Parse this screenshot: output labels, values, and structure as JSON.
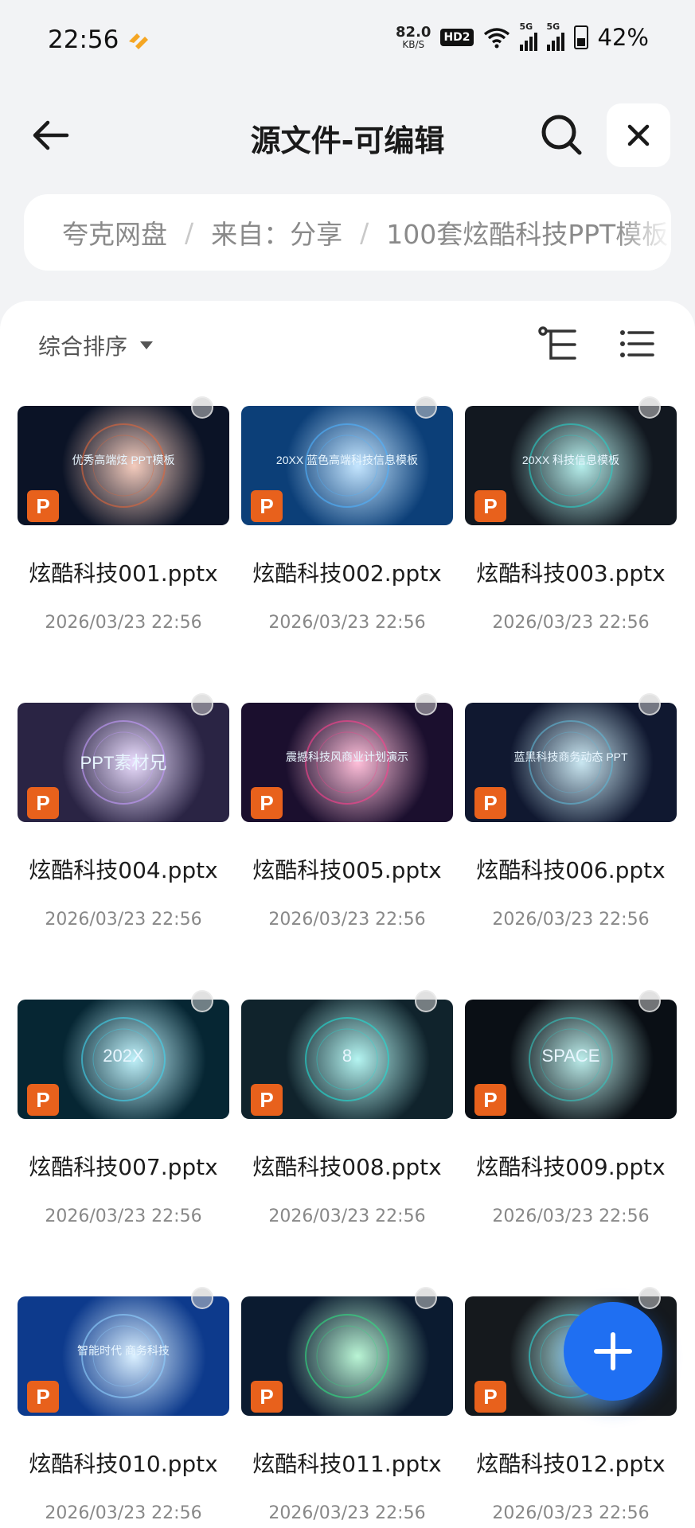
{
  "status_bar": {
    "time": "22:56",
    "net_speed_value": "82.0",
    "net_speed_unit": "KB/S",
    "hd_label": "HD2",
    "signal1_tag": "5G",
    "signal2_tag": "5G",
    "battery_pct": "42%"
  },
  "header": {
    "title": "源文件-可编辑"
  },
  "breadcrumb": {
    "items": [
      "夸克网盘",
      "来自：分享",
      "100套炫酷科技PPT模板"
    ]
  },
  "toolbar": {
    "sort_label": "综合排序"
  },
  "files": [
    {
      "name": "炫酷科技001.pptx",
      "date": "2026/03/23 22:56",
      "thumb_text": "优秀高端炫 PPT模板",
      "thumb_bg": "#0b1326",
      "accent": "#e0663a"
    },
    {
      "name": "炫酷科技002.pptx",
      "date": "2026/03/23 22:56",
      "thumb_text": "20XX 蓝色高端科技信息模板",
      "thumb_bg": "#0c3f78",
      "accent": "#4fb3ff"
    },
    {
      "name": "炫酷科技003.pptx",
      "date": "2026/03/23 22:56",
      "thumb_text": "20XX 科技信息模板",
      "thumb_bg": "#121820",
      "accent": "#26d0c8"
    },
    {
      "name": "炫酷科技004.pptx",
      "date": "2026/03/23 22:56",
      "thumb_text": "PPT素材兄",
      "thumb_bg": "#2a2444",
      "accent": "#c49bff"
    },
    {
      "name": "炫酷科技005.pptx",
      "date": "2026/03/23 22:56",
      "thumb_text": "震撼科技风商业计划演示",
      "thumb_bg": "#1b0f2e",
      "accent": "#ff3f8e"
    },
    {
      "name": "炫酷科技006.pptx",
      "date": "2026/03/23 22:56",
      "thumb_text": "蓝黑科技商务动态 PPT",
      "thumb_bg": "#101830",
      "accent": "#5fb7d6"
    },
    {
      "name": "炫酷科技007.pptx",
      "date": "2026/03/23 22:56",
      "thumb_text": "202X",
      "thumb_bg": "#062633",
      "accent": "#3fd6f0"
    },
    {
      "name": "炫酷科技008.pptx",
      "date": "2026/03/23 22:56",
      "thumb_text": "8",
      "thumb_bg": "#10232c",
      "accent": "#1fe0d6"
    },
    {
      "name": "炫酷科技009.pptx",
      "date": "2026/03/23 22:56",
      "thumb_text": "SPACE",
      "thumb_bg": "#0a0f15",
      "accent": "#34c7c0"
    },
    {
      "name": "炫酷科技010.pptx",
      "date": "2026/03/23 22:56",
      "thumb_text": "智能时代 商务科技",
      "thumb_bg": "#0d3a8c",
      "accent": "#8fd0ff"
    },
    {
      "name": "炫酷科技011.pptx",
      "date": "2026/03/23 22:56",
      "thumb_text": "",
      "thumb_bg": "#0b1b30",
      "accent": "#2fe080"
    },
    {
      "name": "炫酷科技012.pptx",
      "date": "2026/03/23 22:56",
      "thumb_text": "",
      "thumb_bg": "#15191d",
      "accent": "#2fd6d6"
    }
  ],
  "icons": {
    "back": "arrow-left-icon",
    "search": "search-icon",
    "close": "close-icon",
    "tree": "tree-view-icon",
    "list": "list-view-icon",
    "add": "plus-icon",
    "file_type": "ppt-icon"
  },
  "colors": {
    "ppt_badge": "#e8611c",
    "fab": "#1f6ff2"
  }
}
